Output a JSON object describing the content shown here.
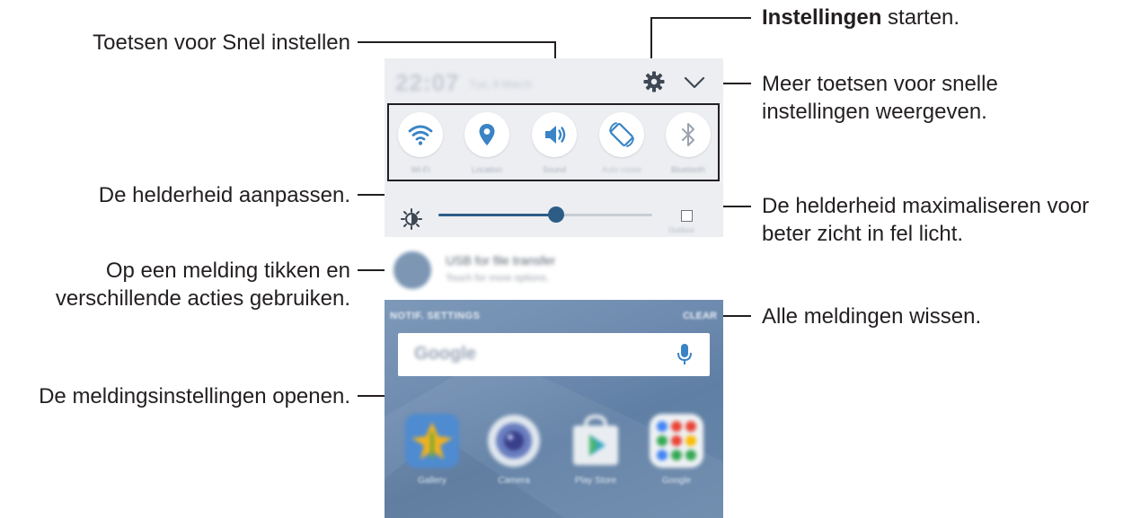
{
  "callouts": {
    "quick_settings": "Toetsen voor Snel instellen",
    "settings_bold": "Instellingen",
    "settings_rest": " starten.",
    "more_buttons_line1": "Meer toetsen voor snelle",
    "more_buttons_line2": "instellingen weergeven.",
    "brightness": "De helderheid aanpassen.",
    "maximize_line1": "De helderheid maximaliseren voor",
    "maximize_line2": "beter zicht in fel licht.",
    "tap_notification_line1": "Op een melding tikken en",
    "tap_notification_line2": "verschillende acties gebruiken.",
    "clear_all": "Alle meldingen wissen.",
    "notification_settings": "De meldingsinstellingen openen."
  },
  "phone": {
    "status": {
      "clock": "22:07",
      "date": "Tue, 8 March"
    },
    "quick_settings": [
      {
        "label": "Wi-Fi",
        "icon": "wifi-icon"
      },
      {
        "label": "Location",
        "icon": "location-icon"
      },
      {
        "label": "Sound",
        "icon": "sound-icon"
      },
      {
        "label": "Auto rotate",
        "icon": "rotate-icon"
      },
      {
        "label": "Bluetooth",
        "icon": "bluetooth-icon"
      }
    ],
    "brightness": {
      "level": 0.55,
      "outdoor_label": "Outdoor"
    },
    "notification": {
      "title": "USB for file transfer",
      "subtitle": "Touch for more options."
    },
    "notify_settings": "NOTIF. SETTINGS",
    "clear": "CLEAR",
    "search_logo": "Google",
    "apps": [
      {
        "label": "Gallery",
        "icon": "gallery-icon"
      },
      {
        "label": "Camera",
        "icon": "camera-icon"
      },
      {
        "label": "Play Store",
        "icon": "play-store-icon"
      },
      {
        "label": "Google",
        "icon": "google-apps-icon"
      }
    ]
  },
  "colors": {
    "accent": "#2d5d86",
    "icon_blue": "#3a84c5",
    "text": "#231f20"
  }
}
